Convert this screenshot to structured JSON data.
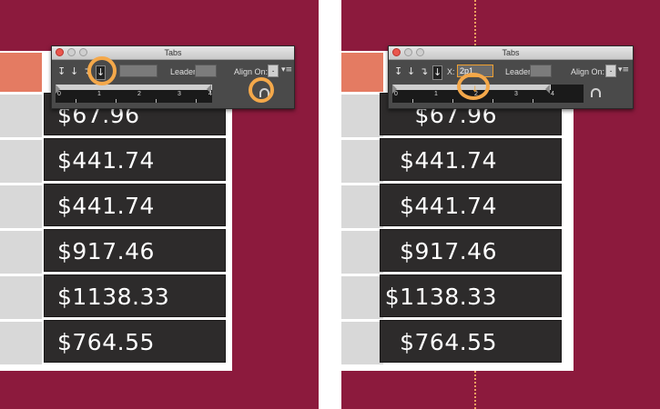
{
  "colors": {
    "background": "#8c1a3d",
    "highlight": "#f4a84a",
    "cell_dark": "#2d2b2b",
    "header_cell": "#e47b62",
    "side_cell": "#d8d8d8"
  },
  "prices": [
    "$67.96",
    "$441.74",
    "$441.74",
    "$917.46",
    "$1138.33",
    "$764.55"
  ],
  "left_panel": {
    "window": {
      "title": "Tabs",
      "leader_label": "Leader:",
      "align_on_label": "Align On:",
      "align_on_value": ".",
      "position_value": "",
      "tab_icons": [
        "left-justified-tab-icon",
        "center-justified-tab-icon",
        "right-justified-tab-icon",
        "decimal-tab-icon"
      ],
      "ruler_numbers": [
        "0",
        "1",
        "2",
        "3",
        "4"
      ],
      "magnet_icon": "magnet-icon"
    }
  },
  "right_panel": {
    "window": {
      "title": "Tabs",
      "x_label": "X:",
      "position_value": "2p1",
      "leader_label": "Leader:",
      "align_on_label": "Align On:",
      "align_on_value": ".",
      "tab_icons": [
        "left-justified-tab-icon",
        "center-justified-tab-icon",
        "right-justified-tab-icon",
        "decimal-tab-icon"
      ],
      "ruler_numbers": [
        "0",
        "1",
        "2",
        "3",
        "4"
      ],
      "magnet_icon": "magnet-icon"
    }
  }
}
